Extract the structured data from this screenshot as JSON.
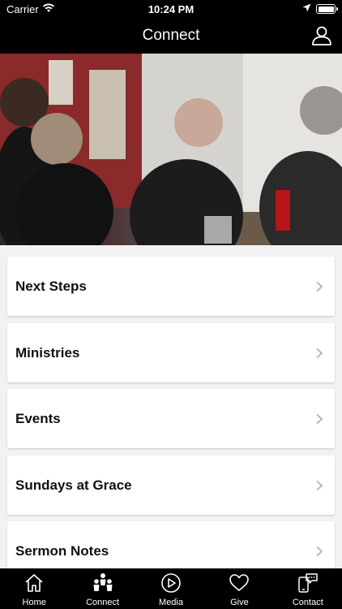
{
  "status_bar": {
    "carrier": "Carrier",
    "time": "10:24 PM"
  },
  "nav": {
    "title": "Connect"
  },
  "menu": [
    {
      "label": "Next Steps"
    },
    {
      "label": "Ministries"
    },
    {
      "label": "Events"
    },
    {
      "label": "Sundays at Grace"
    },
    {
      "label": "Sermon Notes"
    }
  ],
  "tabs": [
    {
      "label": "Home",
      "icon": "home-icon"
    },
    {
      "label": "Connect",
      "icon": "people-icon"
    },
    {
      "label": "Media",
      "icon": "play-icon"
    },
    {
      "label": "Give",
      "icon": "heart-icon"
    },
    {
      "label": "Contact",
      "icon": "chat-phone-icon"
    }
  ]
}
